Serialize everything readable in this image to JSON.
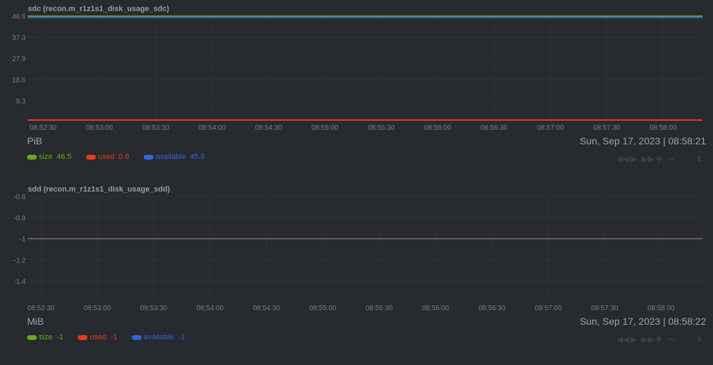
{
  "colors": {
    "size": "#6aa917",
    "used": "#f0381a",
    "available": "#3066d6",
    "grid": "#2f3632",
    "axis": "#7c7f85"
  },
  "chart_data": [
    {
      "type": "line",
      "title": "sdc (recon.m_r1z1s1_disk_usage_sdc)",
      "unit": "PiB",
      "date": "Sun, Sep 17, 2023",
      "time": "08:58:21",
      "yticks": [
        "46.6",
        "37.3",
        "27.9",
        "18.6",
        "9.3"
      ],
      "ylim": [
        0,
        46.6
      ],
      "xticks": [
        "08:52:30",
        "08:53:00",
        "08:53:30",
        "08:54:00",
        "08:54:30",
        "08:55:00",
        "08:55:30",
        "08:56:00",
        "08:56:30",
        "08:57:00",
        "08:57:30",
        "08:58:00"
      ],
      "series": [
        {
          "name": "size",
          "value": "46.5",
          "y": 46.5
        },
        {
          "name": "used",
          "value": "0.6",
          "y": 0.0
        },
        {
          "name": "available",
          "value": "45.9",
          "y": 45.9
        }
      ]
    },
    {
      "type": "line",
      "title": "sdd (recon.m_r1z1s1_disk_usage_sdd)",
      "unit": "MiB",
      "date": "Sun, Sep 17, 2023",
      "time": "08:58:22",
      "yticks": [
        "-0.6",
        "-0.8",
        "-1",
        "-1.2",
        "-1.4"
      ],
      "ylim": [
        -1.5,
        -0.5
      ],
      "xticks": [
        "08:52:30",
        "08:53:00",
        "08:53:30",
        "08:54:00",
        "08:54:30",
        "08:55:00",
        "08:55:30",
        "08:56:00",
        "08:56:30",
        "08:57:00",
        "08:57:30",
        "08:58:00"
      ],
      "series": [
        {
          "name": "size",
          "value": "-1",
          "y": -1
        },
        {
          "name": "used",
          "value": "-1",
          "y": -1
        },
        {
          "name": "available",
          "value": "-1",
          "y": -1
        }
      ]
    }
  ],
  "controls": [
    "◀◀",
    "▶",
    "▶▶",
    "✚",
    "━",
    "⬍"
  ]
}
